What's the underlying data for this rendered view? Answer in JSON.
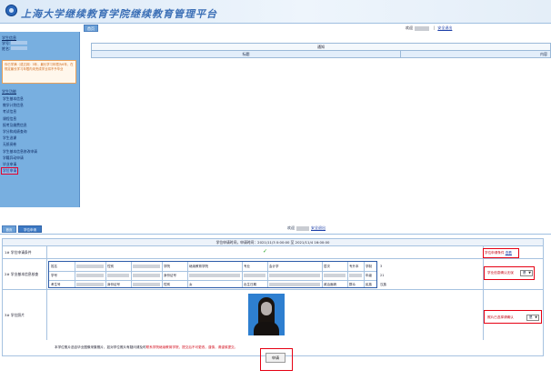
{
  "top": {
    "brand": "上海大学继续教育学院继续教育管理平台",
    "user_prefix": "欢迎",
    "separator": "|",
    "logout": "安全退出",
    "tab_first": "首页",
    "sidebar": {
      "student_info_head": "学生信息",
      "student_no_label": "学号:",
      "name_label": "姓名:",
      "notice": "你已学满（或达到）3年，最长学习年限为6年，在规定最长学习年限内未完成学业将不予毕业",
      "menu_head": "学生功能",
      "menu": [
        "学生基本信息",
        "教学计划信息",
        "考试信息",
        "课程信息",
        "报考及缴费信息",
        "学分和成绩查询",
        "学生选课",
        "无纸阅卷",
        "学生基本信息修改申请",
        "学籍异动申请",
        "毕业申请",
        "学位申请"
      ],
      "active_index": 11
    },
    "table": {
      "title": "通知",
      "col_title": "标题",
      "col_content": "内容"
    }
  },
  "bottom": {
    "tab_a": "首页",
    "tab_b": "学位申请",
    "user_prefix": "欢迎",
    "logout": "安全退出",
    "period": "学位申请时间，申请时间：2021/11/3 0:00:00 至 2021/11/4 16:00:00",
    "check_mark": "✓",
    "rows": [
      {
        "label": "1# 学位申请条件",
        "right": "学位申请条件",
        "right_link": "查看"
      },
      {
        "label": "2# 学业基本信息核查",
        "right": "学业信息确认无误",
        "select": "是"
      },
      {
        "label": "3# 学位照片",
        "right": "照片已选择请确认",
        "select": "是"
      }
    ],
    "grid": {
      "r1": [
        "姓名",
        "",
        "性别",
        "",
        "学院",
        "继续教育学院",
        "专业",
        "会计学",
        "层次",
        "专升本",
        "学制",
        "3"
      ],
      "r2": [
        "学号",
        "",
        "",
        "",
        "身份证号",
        "",
        "",
        "",
        "",
        "",
        "年级",
        "21"
      ],
      "r3": [
        "考生号",
        "",
        "身份证号",
        "",
        "性别",
        "女",
        "出生日期",
        "",
        "政治面貌",
        "群众",
        "民族",
        "汉族"
      ]
    },
    "footnote_a": "本学位照片选自毕业图像采集照片，如对学位照片有疑问请及时",
    "footnote_b": "联系学院继续教育学院，提交后不可更改，谨慎，请谨慎提交。",
    "apply": "申请"
  },
  "colors": {
    "sidebar": "#78afe0",
    "highlight": "#e60012",
    "link": "#1c3fa8",
    "tab": "#6a9fd6"
  }
}
